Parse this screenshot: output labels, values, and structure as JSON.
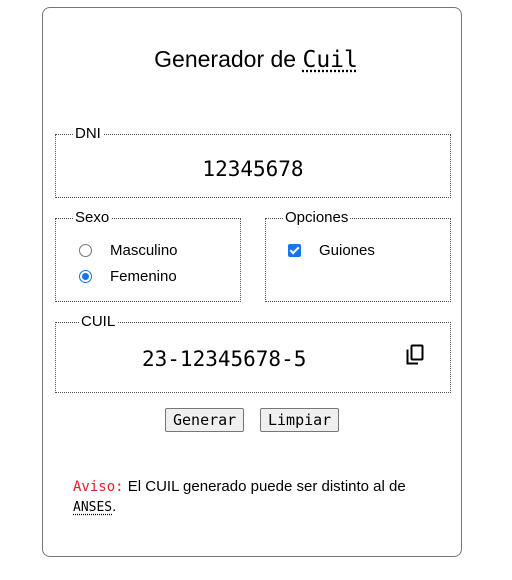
{
  "header": {
    "title_prefix": "Generador de",
    "title_abbr": "Cuil"
  },
  "dni": {
    "legend": "DNI",
    "value": "12345678"
  },
  "sexo": {
    "legend": "Sexo",
    "options": [
      {
        "label": "Masculino",
        "checked": false
      },
      {
        "label": "Femenino",
        "checked": true
      }
    ]
  },
  "opciones": {
    "legend": "Opciones",
    "options": [
      {
        "label": "Guiones",
        "checked": true
      }
    ]
  },
  "cuil": {
    "legend": "CUIL",
    "value": "23-12345678-5",
    "copy_icon": "copy-icon"
  },
  "actions": {
    "generate_label": "Generar",
    "clear_label": "Limpiar"
  },
  "notice": {
    "warning_label": "Aviso:",
    "text": "El CUIL generado puede ser distinto al de",
    "abbr": "ANSES",
    "end": "."
  },
  "colors": {
    "accent": "#1a73e8",
    "warning": "#e0202a",
    "border": "#777777",
    "button_bg": "#efefef"
  }
}
